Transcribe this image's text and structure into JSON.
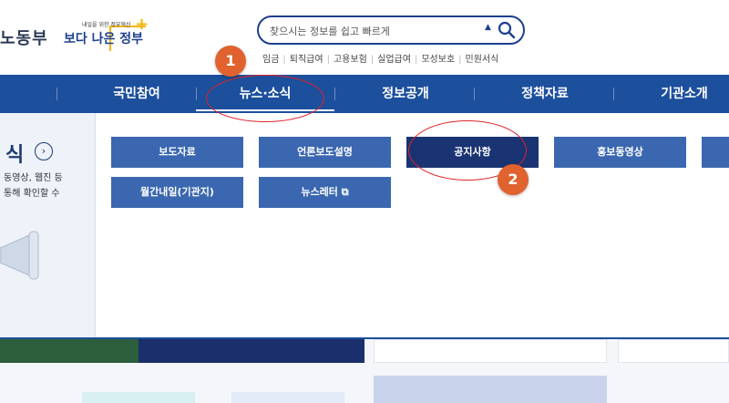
{
  "header": {
    "site_name": "노동부",
    "gov_logo_tagline": "내일을 위한 정부혁신",
    "gov_logo_main": "보다 나은 정부",
    "search_placeholder": "찾으시는 정보를 쉽고 빠르게",
    "quick_links": [
      "임금",
      "퇴직급여",
      "고용보험",
      "실업급여",
      "모성보호",
      "민원서식"
    ]
  },
  "nav": {
    "items": [
      {
        "label": "국민참여"
      },
      {
        "label": "뉴스·소식"
      },
      {
        "label": "정보공개"
      },
      {
        "label": "정책자료"
      },
      {
        "label": "기관소개"
      }
    ],
    "active_index": 1
  },
  "dropdown": {
    "left_title": "식",
    "left_desc_lines": [
      "동영상, 웹진 등",
      "통해 확인할 수"
    ],
    "buttons": [
      {
        "label": "보도자료"
      },
      {
        "label": "언론보도설명"
      },
      {
        "label": "공지사항"
      },
      {
        "label": "홍보동영상"
      },
      {
        "label": "월간내일(기관지)"
      },
      {
        "label": "뉴스레터 ⧉"
      }
    ],
    "active_button": "공지사항"
  },
  "annotations": {
    "step1": "1",
    "step2": "2",
    "color": "#e0232a"
  },
  "colors": {
    "nav_bg": "#1c4f9c",
    "button_bg": "#3b67b0",
    "button_active_bg": "#1a3473"
  }
}
